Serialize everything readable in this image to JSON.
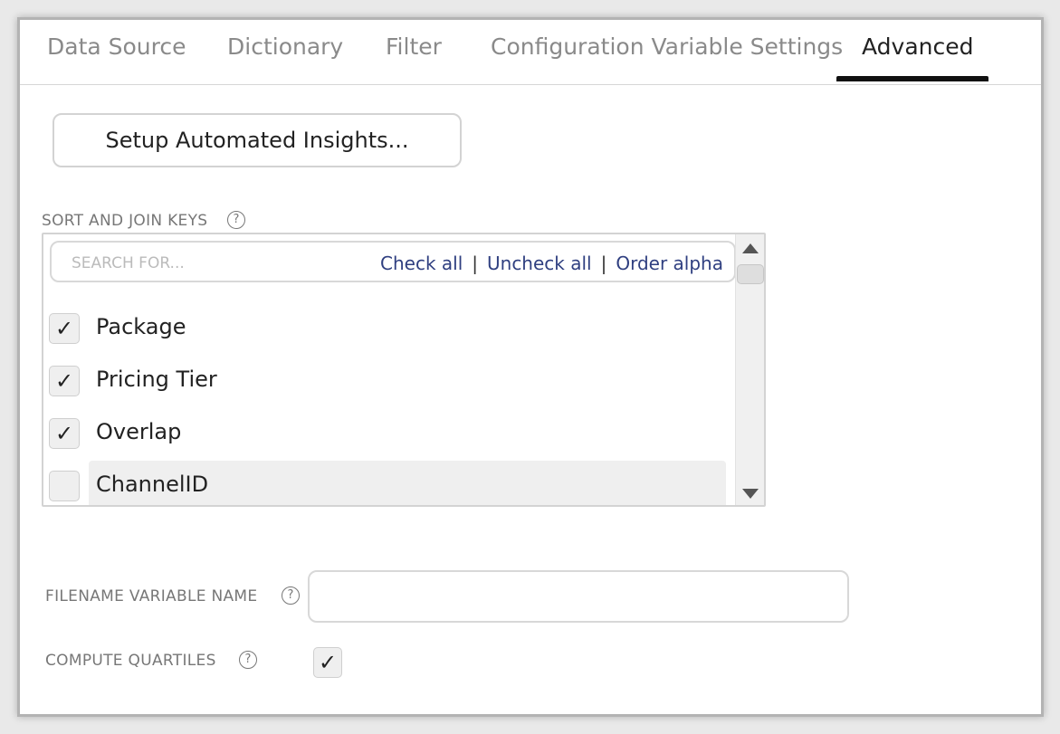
{
  "tabs": [
    {
      "label": "Data Source"
    },
    {
      "label": "Dictionary"
    },
    {
      "label": "Filter"
    },
    {
      "label": "Configuration Variable Settings"
    },
    {
      "label": "Advanced"
    }
  ],
  "setup_button": {
    "label": "Setup Automated Insights..."
  },
  "sort_join": {
    "label": "SORT AND JOIN KEYS",
    "help": "?",
    "search_placeholder": "SEARCH FOR...",
    "check_all": "Check all",
    "uncheck_all": "Uncheck all",
    "order_alpha": "Order alpha",
    "separator": "|",
    "items": [
      {
        "label": "Package",
        "checked": true
      },
      {
        "label": "Pricing Tier",
        "checked": true
      },
      {
        "label": "Overlap",
        "checked": true
      },
      {
        "label": "ChannelID",
        "checked": false
      }
    ],
    "check_glyph": "✓"
  },
  "filename_var": {
    "label": "FILENAME VARIABLE NAME",
    "help": "?",
    "value": ""
  },
  "compute_quartiles": {
    "label": "COMPUTE QUARTILES",
    "help": "?",
    "checked": true,
    "check_glyph": "✓"
  }
}
